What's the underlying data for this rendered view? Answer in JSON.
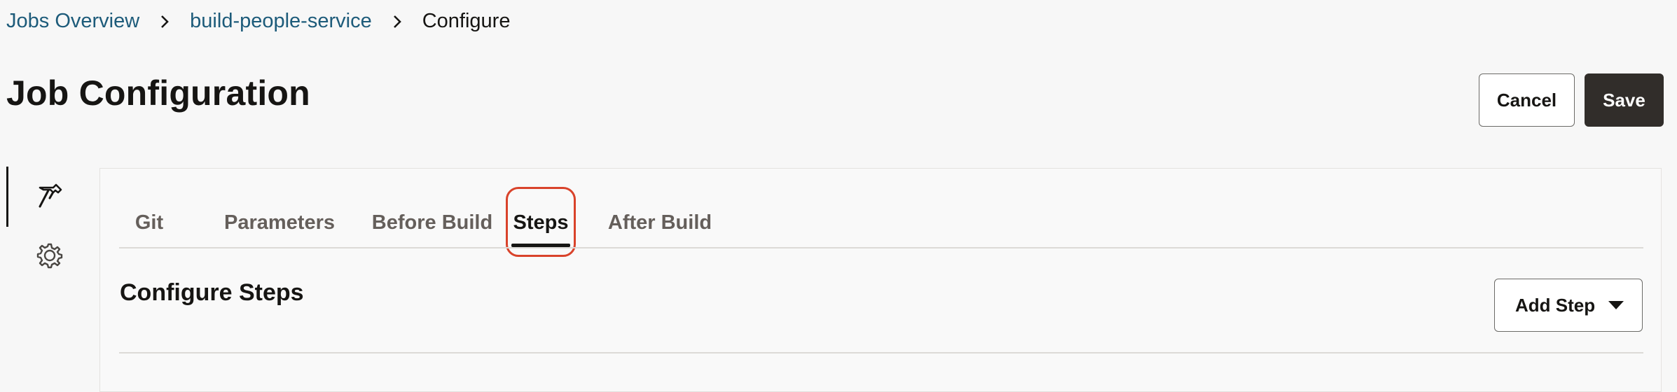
{
  "breadcrumb": {
    "items": [
      "Jobs Overview",
      "build-people-service"
    ],
    "current": "Configure"
  },
  "page": {
    "title": "Job Configuration"
  },
  "actions": {
    "cancel_label": "Cancel",
    "save_label": "Save"
  },
  "sidebar": {
    "items": [
      {
        "icon": "hammer-icon",
        "active": true
      },
      {
        "icon": "gear-icon",
        "active": false
      }
    ]
  },
  "tabs": {
    "items": [
      "Git",
      "Parameters",
      "Before Build",
      "Steps",
      "After Build"
    ],
    "selected": "Steps"
  },
  "section": {
    "title": "Configure Steps",
    "add_step_label": "Add Step"
  },
  "colors": {
    "link": "#1d5b7a",
    "primary_button": "#312d2a",
    "highlight": "#d9432b"
  }
}
